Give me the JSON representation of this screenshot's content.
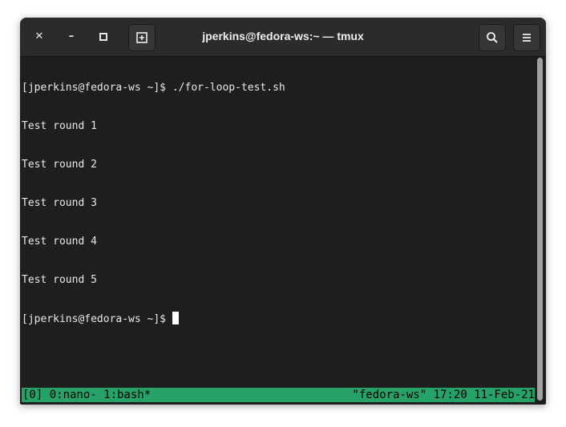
{
  "window": {
    "title": "jperkins@fedora-ws:~ — tmux"
  },
  "controls": {
    "close": "✕",
    "minimize": "–",
    "maximize": "▫"
  },
  "terminal": {
    "lines": [
      "[jperkins@fedora-ws ~]$ ./for-loop-test.sh",
      "Test round 1",
      "Test round 2",
      "Test round 3",
      "Test round 4",
      "Test round 5"
    ],
    "prompt": "[jperkins@fedora-ws ~]$ "
  },
  "tmux": {
    "left": "[0] 0:nano- 1:bash*",
    "right": "\"fedora-ws\" 17:20 11-Feb-21"
  },
  "colors": {
    "status_bar": "#26a269"
  }
}
